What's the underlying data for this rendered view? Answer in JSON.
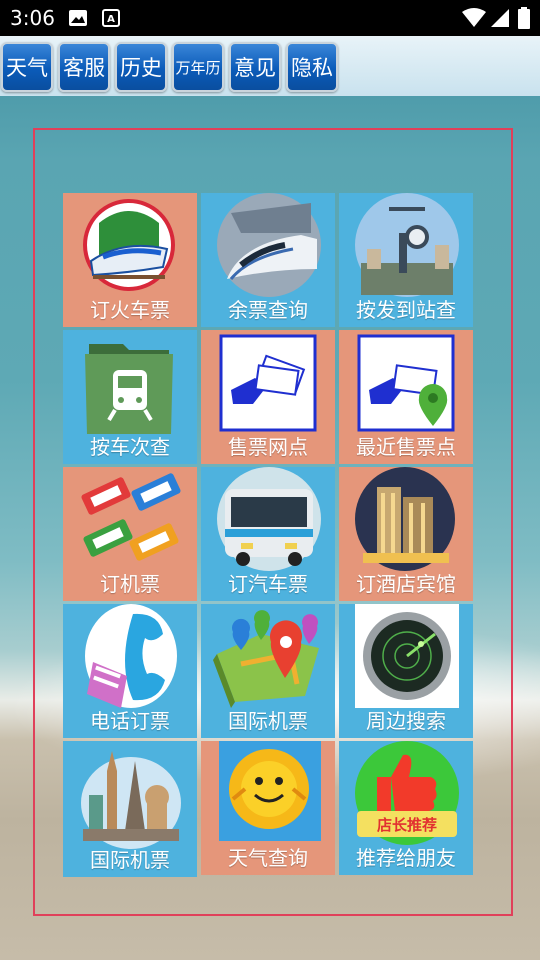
{
  "status_bar": {
    "time": "3:06",
    "icons": [
      "image-icon",
      "text-icon",
      "wifi-icon",
      "signal-icon",
      "battery-icon"
    ]
  },
  "toolbar": {
    "buttons": [
      {
        "label": "天气"
      },
      {
        "label": "客服"
      },
      {
        "label": "历史"
      },
      {
        "label": "万年历"
      },
      {
        "label": "意见"
      },
      {
        "label": "隐私"
      }
    ]
  },
  "grid": {
    "tiles": [
      {
        "label": "订火车票",
        "icon": "train-icon",
        "color": "#e5967a"
      },
      {
        "label": "余票查询",
        "icon": "bullet-train-icon",
        "color": "#4eb2de"
      },
      {
        "label": "按发到站查",
        "icon": "city-clock-icon",
        "color": "#4eb2de"
      },
      {
        "label": "按车次查",
        "icon": "train-folder-icon",
        "color": "#4eb2de"
      },
      {
        "label": "售票网点",
        "icon": "ticket-hand-icon",
        "color": "#e5967a"
      },
      {
        "label": "最近售票点",
        "icon": "ticket-location-icon",
        "color": "#e5967a"
      },
      {
        "label": "订机票",
        "icon": "plane-tickets-icon",
        "color": "#e5967a"
      },
      {
        "label": "订汽车票",
        "icon": "bus-icon",
        "color": "#4eb2de"
      },
      {
        "label": "订酒店宾馆",
        "icon": "hotel-icon",
        "color": "#e5967a"
      },
      {
        "label": "电话订票",
        "icon": "phone-icon",
        "color": "#4eb2de"
      },
      {
        "label": "国际机票",
        "icon": "map-pins-icon",
        "color": "#4eb2de"
      },
      {
        "label": "周边搜索",
        "icon": "radar-icon",
        "color": "#4eb2de"
      },
      {
        "label": "国际机票",
        "icon": "landmarks-icon",
        "color": "#4eb2de"
      },
      {
        "label": "天气查询",
        "icon": "sun-icon",
        "color": "#e5967a"
      },
      {
        "label": "推荐给朋友",
        "icon": "thumbs-up-icon",
        "color": "#4eb2de"
      }
    ],
    "recommend_badge": "店长推荐"
  }
}
